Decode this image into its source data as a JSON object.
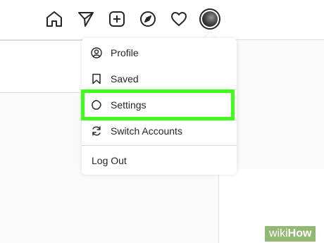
{
  "nav": {
    "icons": [
      "home-icon",
      "direct-message-icon",
      "new-post-icon",
      "explore-icon",
      "activity-heart-icon",
      "profile-avatar"
    ]
  },
  "menu": {
    "items": [
      {
        "label": "Profile",
        "icon": "profile-circle-icon"
      },
      {
        "label": "Saved",
        "icon": "bookmark-icon"
      },
      {
        "label": "Settings",
        "icon": "gear-icon"
      },
      {
        "label": "Switch Accounts",
        "icon": "switch-arrows-icon"
      }
    ],
    "logout_label": "Log Out"
  },
  "highlight": {
    "target": "Settings",
    "color": "#3dff19"
  },
  "watermark": {
    "wiki": "wiki",
    "how": "How"
  }
}
